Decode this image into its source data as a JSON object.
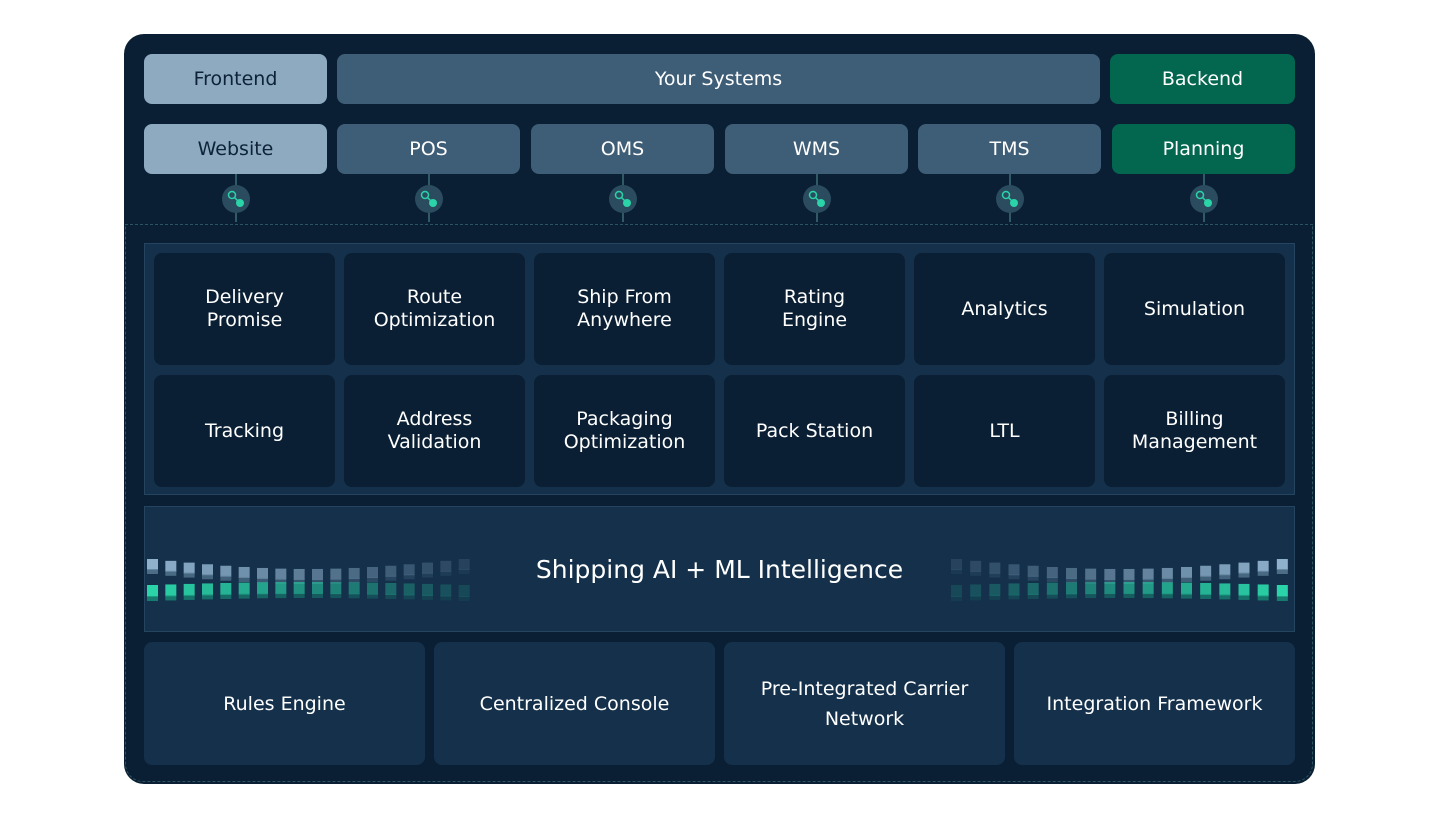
{
  "top_row": {
    "frontend": "Frontend",
    "systems": "Your Systems",
    "backend": "Backend"
  },
  "systems": [
    {
      "label": "Website",
      "style": "light"
    },
    {
      "label": "POS",
      "style": "mid"
    },
    {
      "label": "OMS",
      "style": "mid"
    },
    {
      "label": "WMS",
      "style": "mid"
    },
    {
      "label": "TMS",
      "style": "mid"
    },
    {
      "label": "Planning",
      "style": "green"
    }
  ],
  "modules": [
    [
      "Delivery\nPromise",
      "Route\nOptimization",
      "Ship From\nAnywhere",
      "Rating\nEngine",
      "Analytics",
      "Simulation"
    ],
    [
      "Tracking",
      "Address\nValidation",
      "Packaging\nOptimization",
      "Pack Station",
      "LTL",
      "Billing\nManagement"
    ]
  ],
  "ai_band": {
    "title": "Shipping AI + ML Intelligence"
  },
  "pillars": [
    "Rules Engine",
    "Centralized Console",
    "Pre-Integrated Carrier\nNetwork",
    "Integration Framework"
  ],
  "colors": {
    "background": "#0a1f33",
    "light": "#8daac0",
    "mid": "#3e5d76",
    "green": "#03664f",
    "accent": "#2ad4a8",
    "panel": "#14304a"
  },
  "icons": {
    "connector": "link-connector-icon"
  }
}
